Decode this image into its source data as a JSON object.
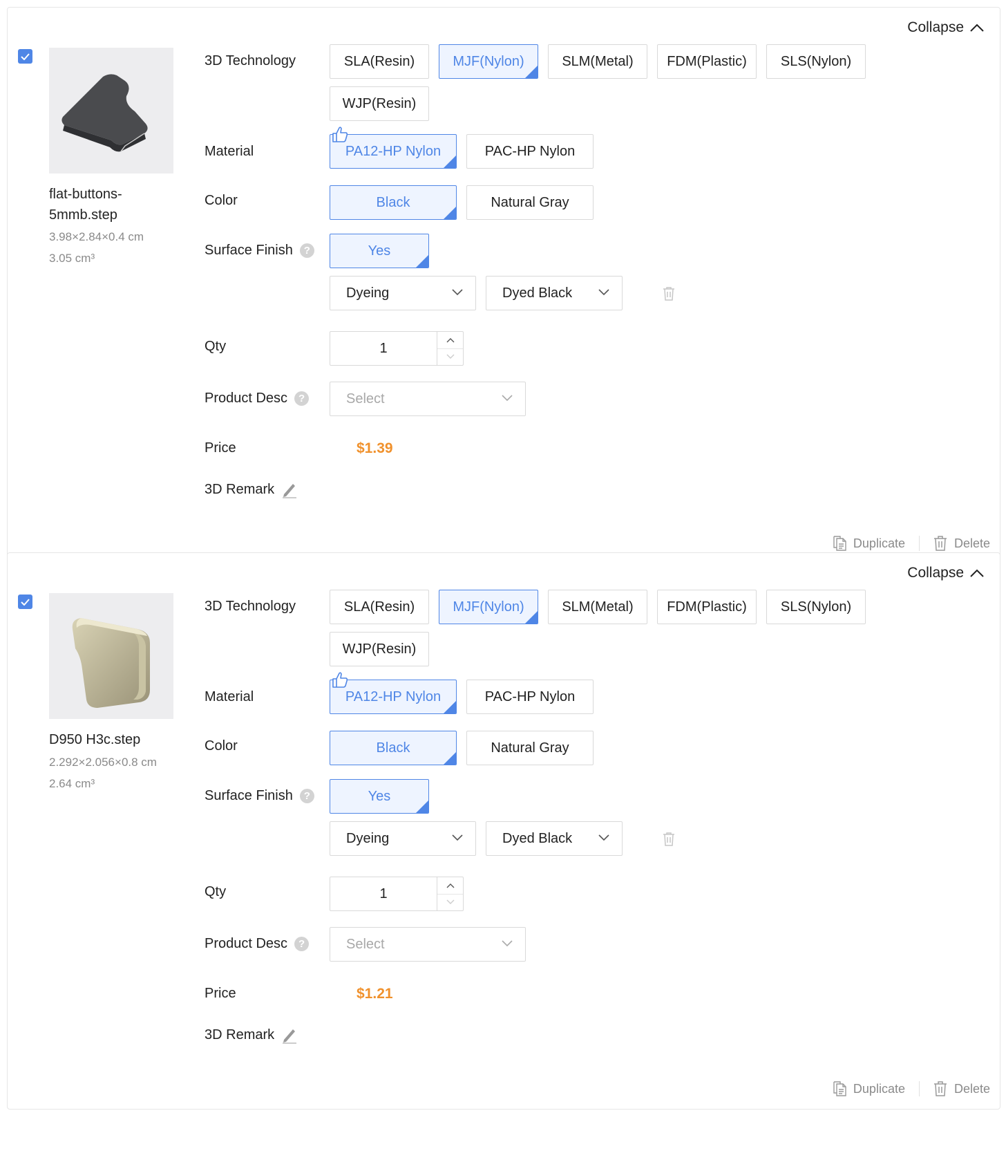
{
  "items": [
    {
      "collapse_label": "Collapse",
      "checked": true,
      "filename": "flat-buttons-5mmb.step",
      "dimensions": "3.98×2.84×0.4 cm",
      "volume": "3.05 cm³",
      "labels": {
        "technology": "3D Technology",
        "material": "Material",
        "color": "Color",
        "surface_finish": "Surface Finish",
        "qty": "Qty",
        "product_desc": "Product Desc",
        "price": "Price",
        "remark": "3D Remark"
      },
      "technologies": [
        "SLA(Resin)",
        "MJF(Nylon)",
        "SLM(Metal)",
        "FDM(Plastic)",
        "SLS(Nylon)",
        "WJP(Resin)"
      ],
      "technology_selected": "MJF(Nylon)",
      "materials": [
        "PA12-HP Nylon",
        "PAC-HP Nylon"
      ],
      "material_selected": "PA12-HP Nylon",
      "colors": [
        "Black",
        "Natural Gray"
      ],
      "color_selected": "Black",
      "surface_finish_options": [
        "Yes"
      ],
      "surface_finish_selected": "Yes",
      "finish_type": "Dyeing",
      "finish_color": "Dyed Black",
      "qty": "1",
      "product_desc_placeholder": "Select",
      "price": "$1.39",
      "duplicate_label": "Duplicate",
      "delete_label": "Delete"
    },
    {
      "collapse_label": "Collapse",
      "checked": true,
      "filename": "D950 H3c.step",
      "dimensions": "2.292×2.056×0.8 cm",
      "volume": "2.64 cm³",
      "labels": {
        "technology": "3D Technology",
        "material": "Material",
        "color": "Color",
        "surface_finish": "Surface Finish",
        "qty": "Qty",
        "product_desc": "Product Desc",
        "price": "Price",
        "remark": "3D Remark"
      },
      "technologies": [
        "SLA(Resin)",
        "MJF(Nylon)",
        "SLM(Metal)",
        "FDM(Plastic)",
        "SLS(Nylon)",
        "WJP(Resin)"
      ],
      "technology_selected": "MJF(Nylon)",
      "materials": [
        "PA12-HP Nylon",
        "PAC-HP Nylon"
      ],
      "material_selected": "PA12-HP Nylon",
      "colors": [
        "Black",
        "Natural Gray"
      ],
      "color_selected": "Black",
      "surface_finish_options": [
        "Yes"
      ],
      "surface_finish_selected": "Yes",
      "finish_type": "Dyeing",
      "finish_color": "Dyed Black",
      "qty": "1",
      "product_desc_placeholder": "Select",
      "price": "$1.21",
      "duplicate_label": "Duplicate",
      "delete_label": "Delete"
    }
  ],
  "colors": {
    "accent": "#4f86e6",
    "price": "#f0912c",
    "selected_bg": "#eef4ff"
  },
  "icons": [
    "chevron-up-icon",
    "checkbox-check-icon",
    "thumbs-up-icon",
    "chevron-down-icon",
    "trash-icon",
    "help-icon",
    "pencil-icon",
    "duplicate-icon"
  ]
}
